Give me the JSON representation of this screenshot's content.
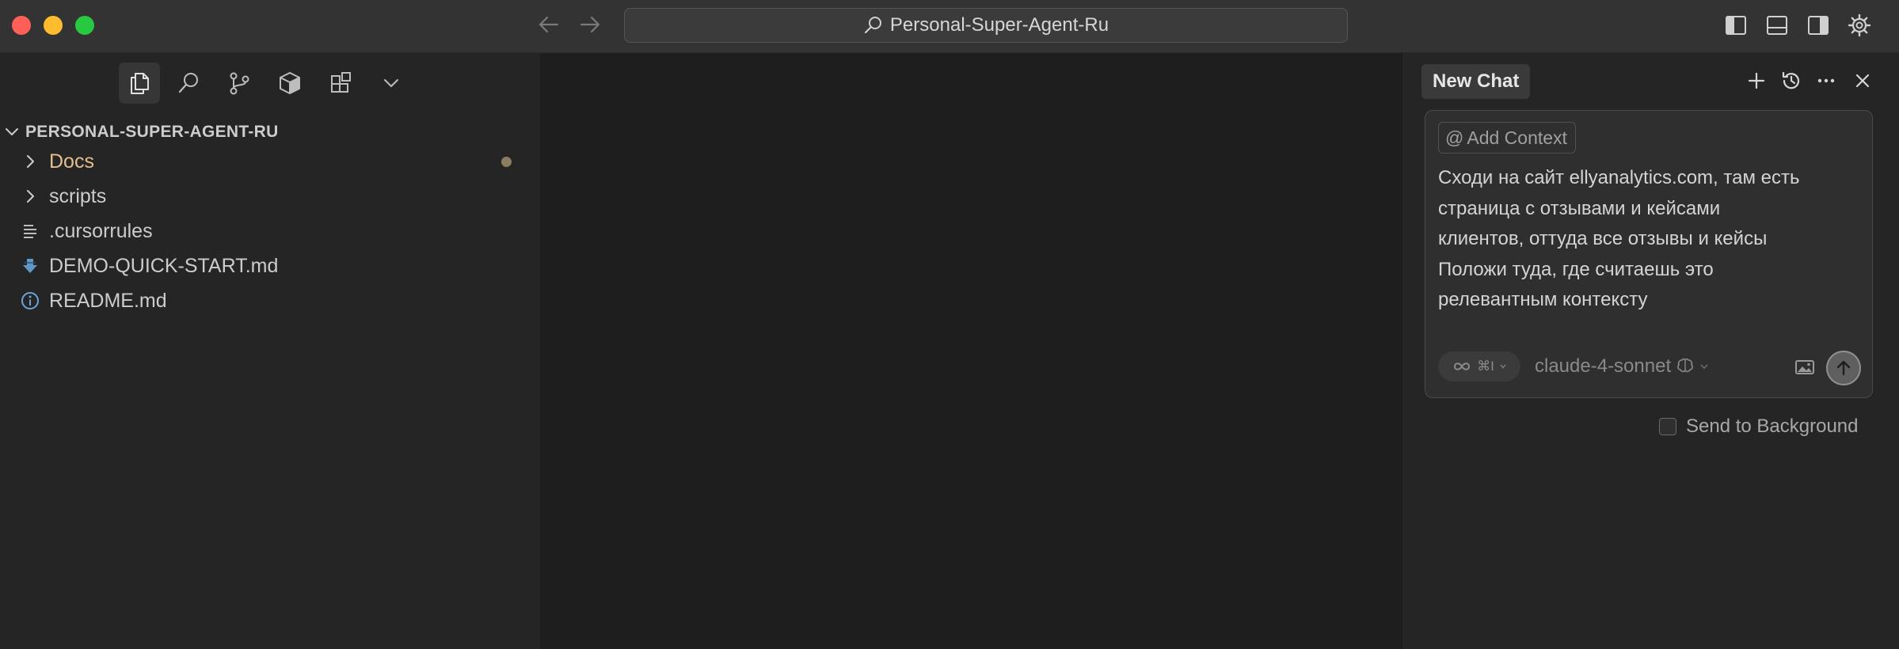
{
  "window": {
    "title": "Personal-Super-Agent-Ru"
  },
  "colors": {
    "accent_modified": "#e2c08d",
    "close": "#ff5f57",
    "minimize": "#febc2e",
    "maximize": "#28c840"
  },
  "toolbar_icons": [
    "panel-left-icon",
    "panel-bottom-icon",
    "panel-right-icon",
    "gear-icon"
  ],
  "sidebar": {
    "activity_icons": [
      "files-icon",
      "search-icon",
      "source-control-icon",
      "extensions-icon",
      "extensions-grid-icon",
      "chevron-down-icon"
    ],
    "root_label": "PERSONAL-SUPER-AGENT-RU",
    "items": [
      {
        "label": "Docs",
        "type": "folder",
        "modified": true
      },
      {
        "label": "scripts",
        "type": "folder",
        "modified": false
      },
      {
        "label": ".cursorrules",
        "type": "file",
        "icon": "lines-icon"
      },
      {
        "label": "DEMO-QUICK-START.md",
        "type": "file",
        "icon": "download-arrow-icon"
      },
      {
        "label": "README.md",
        "type": "file",
        "icon": "info-icon"
      }
    ]
  },
  "chat": {
    "tab_label": "New Chat",
    "actions": [
      "plus-icon",
      "history-icon",
      "more-icon",
      "close-icon"
    ],
    "add_context_label": "Add Context",
    "prompt_lines": [
      "Сходи на сайт ellyanalytics.com, там есть",
      "страница с отзывами и кейсами",
      "клиентов,  оттуда все отзывы и кейсы",
      "Положи туда, где считаешь это",
      "релевантным контексту"
    ],
    "mode_shortcut": "⌘I",
    "model_label": "claude-4-sonnet",
    "send_to_background_label": "Send to Background"
  }
}
